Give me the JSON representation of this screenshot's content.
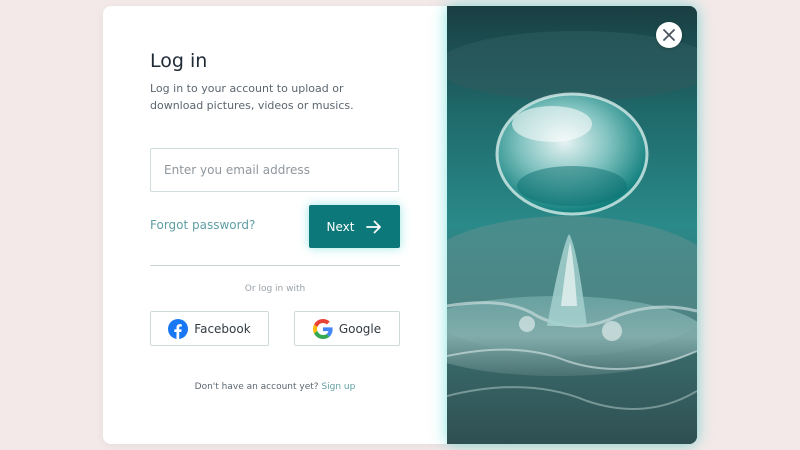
{
  "login": {
    "title": "Log in",
    "subtitle": "Log in to your account to upload or download pictures, videos or musics.",
    "email_placeholder": "Enter you email address",
    "forgot_password": "Forgot password?",
    "next_label": "Next",
    "or_text": "Or log in with",
    "facebook_label": "Facebook",
    "google_label": "Google",
    "no_account_text": "Don't have an account yet?",
    "signup_label": "Sign up"
  },
  "colors": {
    "accent": "#0c787a",
    "link": "#5f9ea3",
    "background": "#f4e9e9"
  },
  "icons": {
    "next": "arrow-right-icon",
    "facebook": "facebook-icon",
    "google": "google-icon",
    "close": "close-icon"
  }
}
